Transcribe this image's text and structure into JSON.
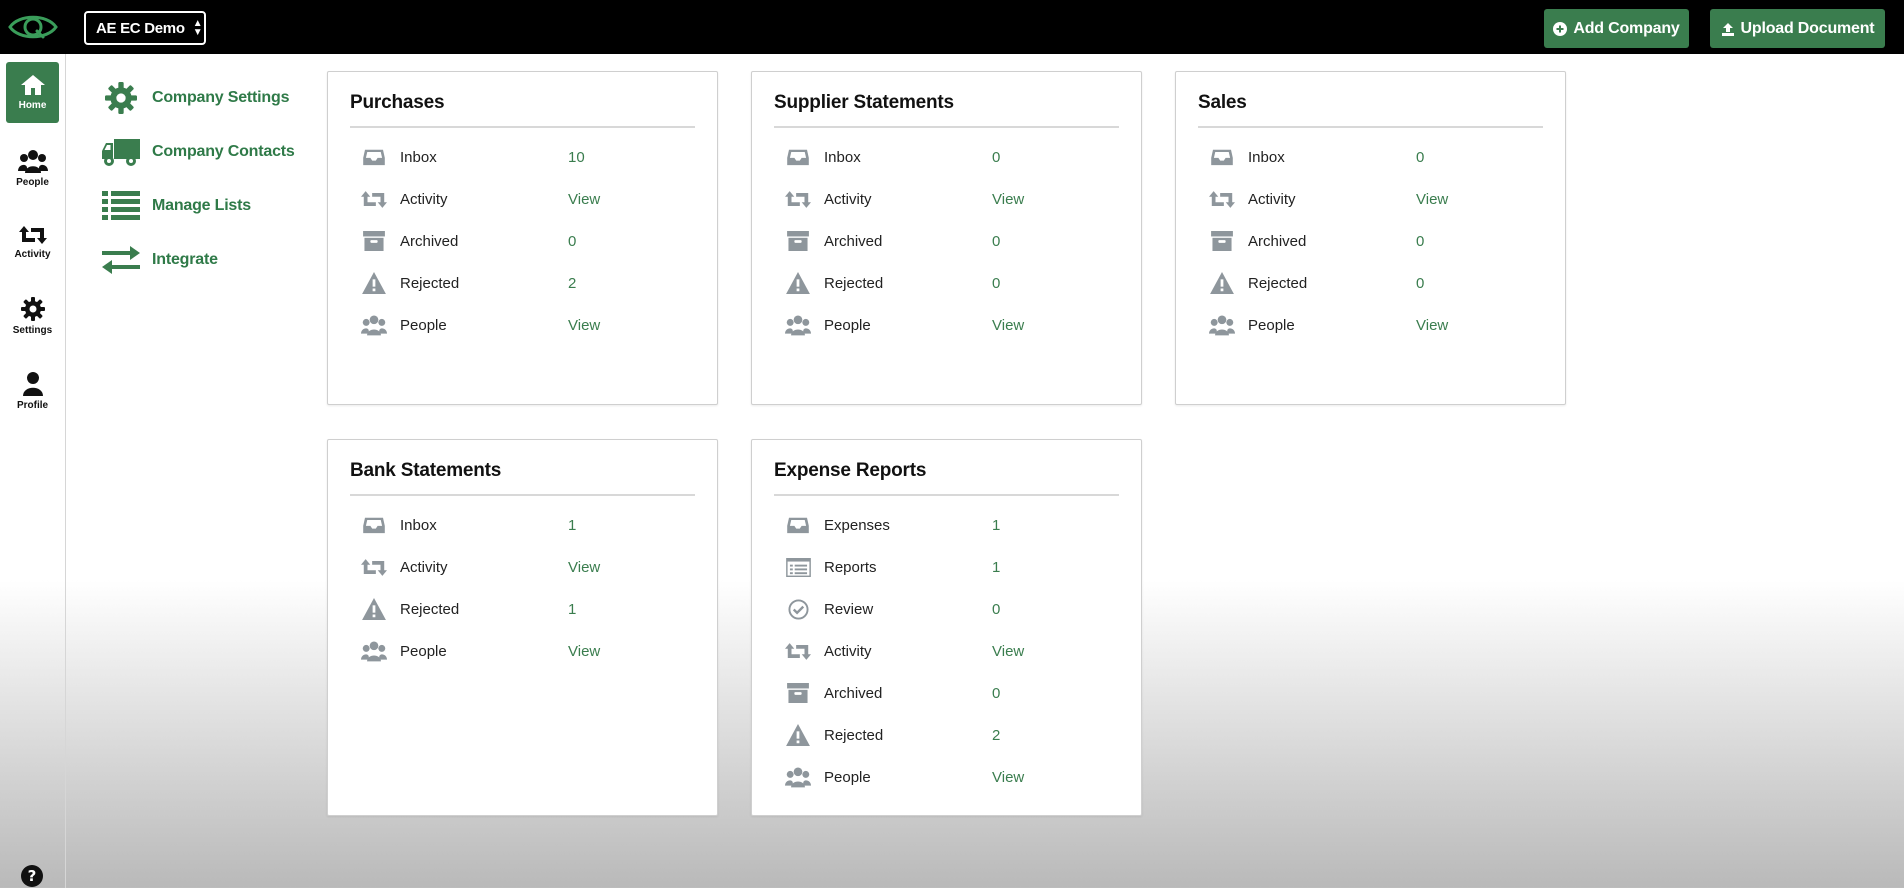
{
  "header": {
    "company": "AE EC Demo",
    "add_company": "Add Company",
    "upload_document": "Upload Document"
  },
  "rail": [
    {
      "label": "Home",
      "icon": "home-icon",
      "active": true
    },
    {
      "label": "People",
      "icon": "people-icon"
    },
    {
      "label": "Activity",
      "icon": "activity-icon"
    },
    {
      "label": "Settings",
      "icon": "gear-icon"
    },
    {
      "label": "Profile",
      "icon": "user-icon"
    }
  ],
  "subnav": [
    {
      "label": "Company Settings",
      "icon": "gear-icon"
    },
    {
      "label": "Company Contacts",
      "icon": "truck-icon"
    },
    {
      "label": "Manage Lists",
      "icon": "list-icon"
    },
    {
      "label": "Integrate",
      "icon": "exchange-icon"
    }
  ],
  "cards": {
    "purchases": {
      "title": "Purchases",
      "rows": [
        {
          "label": "Inbox",
          "value": "10",
          "icon": "inbox-icon"
        },
        {
          "label": "Activity",
          "value": "View",
          "icon": "activity-icon"
        },
        {
          "label": "Archived",
          "value": "0",
          "icon": "archive-icon"
        },
        {
          "label": "Rejected",
          "value": "2",
          "icon": "warning-icon"
        },
        {
          "label": "People",
          "value": "View",
          "icon": "people-icon"
        }
      ]
    },
    "supplier": {
      "title": "Supplier Statements",
      "rows": [
        {
          "label": "Inbox",
          "value": "0",
          "icon": "inbox-icon"
        },
        {
          "label": "Activity",
          "value": "View",
          "icon": "activity-icon"
        },
        {
          "label": "Archived",
          "value": "0",
          "icon": "archive-icon"
        },
        {
          "label": "Rejected",
          "value": "0",
          "icon": "warning-icon"
        },
        {
          "label": "People",
          "value": "View",
          "icon": "people-icon"
        }
      ]
    },
    "sales": {
      "title": "Sales",
      "rows": [
        {
          "label": "Inbox",
          "value": "0",
          "icon": "inbox-icon"
        },
        {
          "label": "Activity",
          "value": "View",
          "icon": "activity-icon"
        },
        {
          "label": "Archived",
          "value": "0",
          "icon": "archive-icon"
        },
        {
          "label": "Rejected",
          "value": "0",
          "icon": "warning-icon"
        },
        {
          "label": "People",
          "value": "View",
          "icon": "people-icon"
        }
      ]
    },
    "bank": {
      "title": "Bank Statements",
      "rows": [
        {
          "label": "Inbox",
          "value": "1",
          "icon": "inbox-icon"
        },
        {
          "label": "Activity",
          "value": "View",
          "icon": "activity-icon"
        },
        {
          "label": "Rejected",
          "value": "1",
          "icon": "warning-icon"
        },
        {
          "label": "People",
          "value": "View",
          "icon": "people-icon"
        }
      ]
    },
    "expense": {
      "title": "Expense Reports",
      "rows": [
        {
          "label": "Expenses",
          "value": "1",
          "icon": "inbox-icon"
        },
        {
          "label": "Reports",
          "value": "1",
          "icon": "list-alt-icon"
        },
        {
          "label": "Review",
          "value": "0",
          "icon": "check-circle-icon"
        },
        {
          "label": "Activity",
          "value": "View",
          "icon": "activity-icon"
        },
        {
          "label": "Archived",
          "value": "0",
          "icon": "archive-icon"
        },
        {
          "label": "Rejected",
          "value": "2",
          "icon": "warning-icon"
        },
        {
          "label": "People",
          "value": "View",
          "icon": "people-icon"
        }
      ]
    }
  }
}
